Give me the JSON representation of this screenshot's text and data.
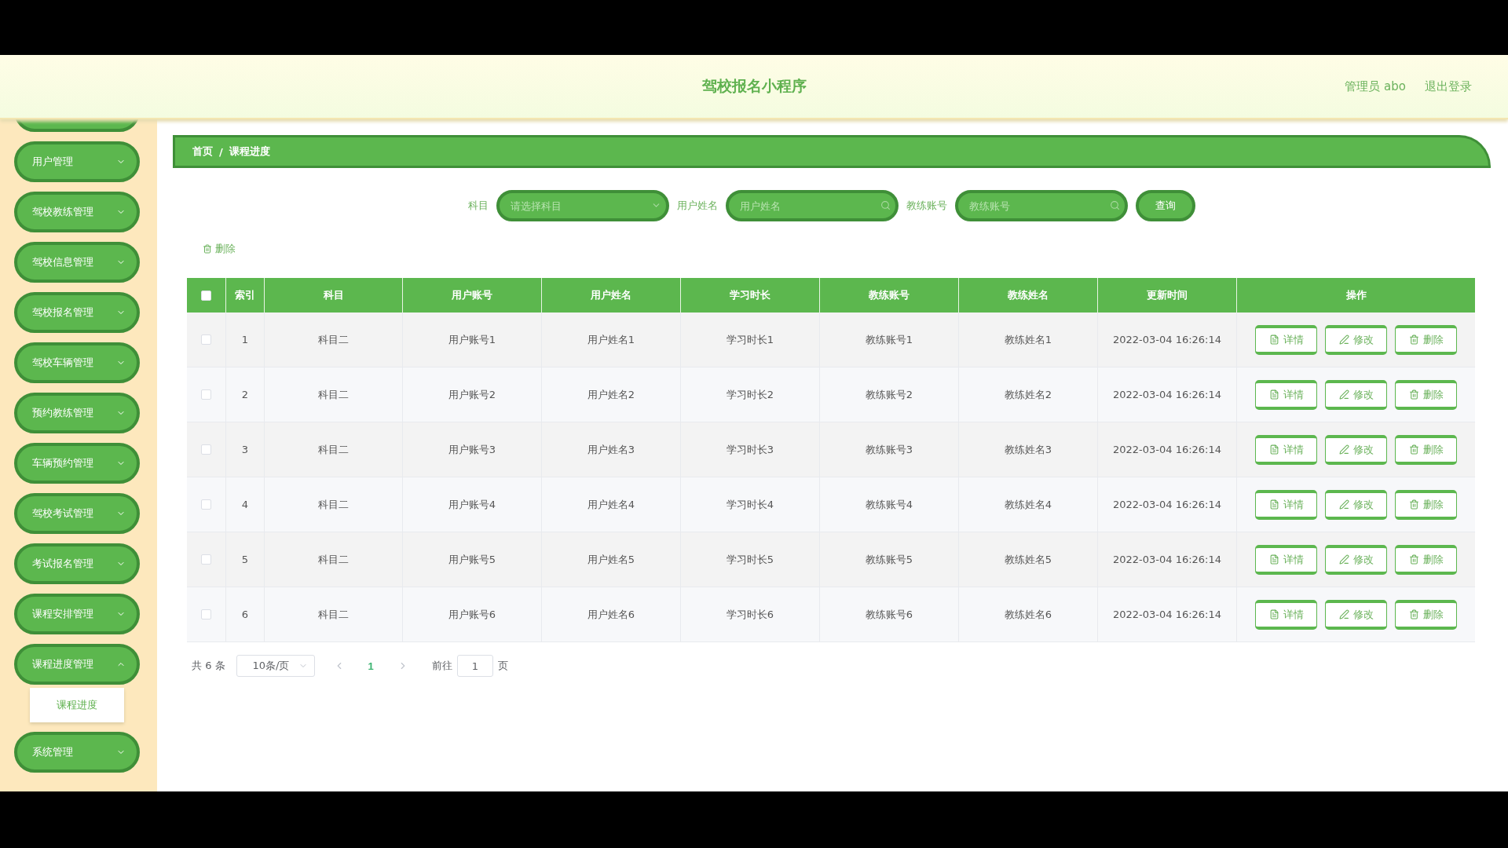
{
  "header": {
    "title": "驾校报名小程序",
    "user": "管理员 abo",
    "logout": "退出登录"
  },
  "sidebar": {
    "items": [
      {
        "label": "用户管理",
        "expanded": false
      },
      {
        "label": "驾校教练管理",
        "expanded": false
      },
      {
        "label": "驾校信息管理",
        "expanded": false
      },
      {
        "label": "驾校报名管理",
        "expanded": false
      },
      {
        "label": "驾校车辆管理",
        "expanded": false
      },
      {
        "label": "预约教练管理",
        "expanded": false
      },
      {
        "label": "车辆预约管理",
        "expanded": false
      },
      {
        "label": "驾校考试管理",
        "expanded": false
      },
      {
        "label": "考试报名管理",
        "expanded": false
      },
      {
        "label": "课程安排管理",
        "expanded": false
      },
      {
        "label": "课程进度管理",
        "expanded": true,
        "children": [
          {
            "label": "课程进度"
          }
        ]
      },
      {
        "label": "系统管理",
        "expanded": false
      }
    ]
  },
  "breadcrumb": [
    "首页",
    "/",
    "课程进度"
  ],
  "search": {
    "fields": [
      {
        "kind": "select",
        "label": "科目",
        "placeholder": "请选择科目"
      },
      {
        "kind": "input",
        "label": "用户姓名",
        "placeholder": "用户姓名"
      },
      {
        "kind": "input",
        "label": "教练账号",
        "placeholder": "教练账号"
      }
    ],
    "button": "查询"
  },
  "toolbar": {
    "delete": "删除"
  },
  "table": {
    "header_checked": false,
    "columns": [
      "索引",
      "科目",
      "用户账号",
      "用户姓名",
      "学习时长",
      "教练账号",
      "教练姓名",
      "更新时间",
      "操作"
    ],
    "rows": [
      {
        "checked": false,
        "cells": [
          "1",
          "科目二",
          "用户账号1",
          "用户姓名1",
          "学习时长1",
          "教练账号1",
          "教练姓名1",
          "2022-03-04 16:26:14"
        ],
        "actions": [
          {
            "kind": "detail",
            "label": "详情"
          },
          {
            "kind": "edit",
            "label": "修改"
          },
          {
            "kind": "delete",
            "label": "删除"
          }
        ]
      },
      {
        "checked": false,
        "cells": [
          "2",
          "科目二",
          "用户账号2",
          "用户姓名2",
          "学习时长2",
          "教练账号2",
          "教练姓名2",
          "2022-03-04 16:26:14"
        ],
        "actions": [
          {
            "kind": "detail",
            "label": "详情"
          },
          {
            "kind": "edit",
            "label": "修改"
          },
          {
            "kind": "delete",
            "label": "删除"
          }
        ]
      },
      {
        "checked": false,
        "cells": [
          "3",
          "科目二",
          "用户账号3",
          "用户姓名3",
          "学习时长3",
          "教练账号3",
          "教练姓名3",
          "2022-03-04 16:26:14"
        ],
        "actions": [
          {
            "kind": "detail",
            "label": "详情"
          },
          {
            "kind": "edit",
            "label": "修改"
          },
          {
            "kind": "delete",
            "label": "删除"
          }
        ]
      },
      {
        "checked": false,
        "cells": [
          "4",
          "科目二",
          "用户账号4",
          "用户姓名4",
          "学习时长4",
          "教练账号4",
          "教练姓名4",
          "2022-03-04 16:26:14"
        ],
        "actions": [
          {
            "kind": "detail",
            "label": "详情"
          },
          {
            "kind": "edit",
            "label": "修改"
          },
          {
            "kind": "delete",
            "label": "删除"
          }
        ]
      },
      {
        "checked": false,
        "cells": [
          "5",
          "科目二",
          "用户账号5",
          "用户姓名5",
          "学习时长5",
          "教练账号5",
          "教练姓名5",
          "2022-03-04 16:26:14"
        ],
        "actions": [
          {
            "kind": "detail",
            "label": "详情"
          },
          {
            "kind": "edit",
            "label": "修改"
          },
          {
            "kind": "delete",
            "label": "删除"
          }
        ]
      },
      {
        "checked": false,
        "cells": [
          "6",
          "科目二",
          "用户账号6",
          "用户姓名6",
          "学习时长6",
          "教练账号6",
          "教练姓名6",
          "2022-03-04 16:26:14"
        ],
        "actions": [
          {
            "kind": "detail",
            "label": "详情"
          },
          {
            "kind": "edit",
            "label": "修改"
          },
          {
            "kind": "delete",
            "label": "删除"
          }
        ]
      }
    ]
  },
  "pagination": {
    "total": "共 6 条",
    "page_size": "10条/页",
    "pages": [
      {
        "label": "1",
        "selected": true
      }
    ],
    "goto": "前往",
    "goto_value": "1",
    "page_unit": "页"
  }
}
